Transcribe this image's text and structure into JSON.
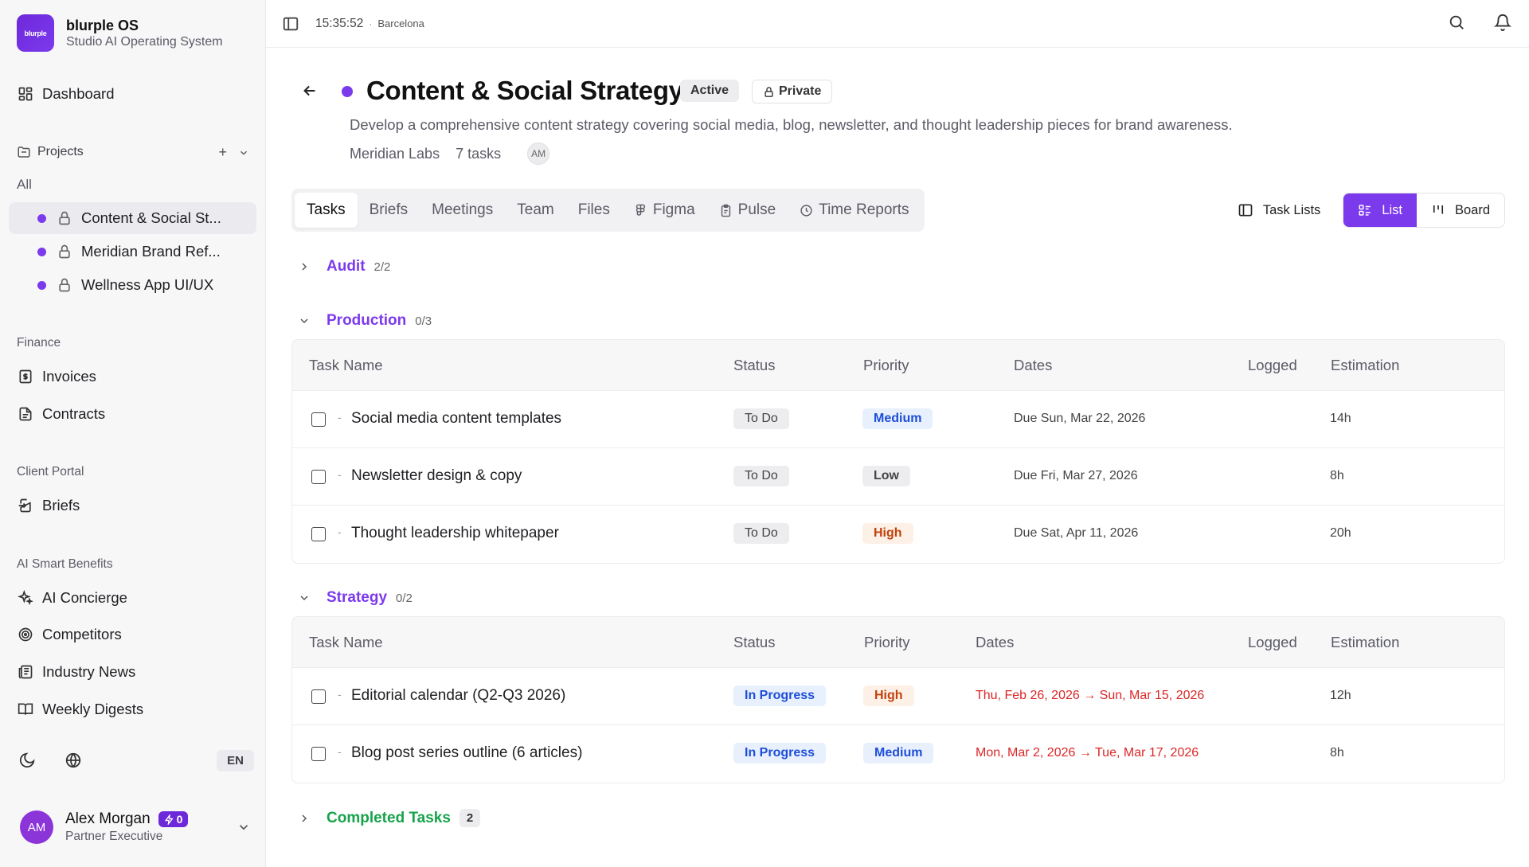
{
  "app": {
    "name": "blurple OS",
    "subtitle": "Studio AI Operating System",
    "logo_text": "blurple"
  },
  "sidebar": {
    "dashboard": "Dashboard",
    "projects_label": "Projects",
    "all_label": "All",
    "projects": [
      {
        "label": "Content & Social St..."
      },
      {
        "label": "Meridian Brand Ref..."
      },
      {
        "label": "Wellness App UI/UX"
      }
    ],
    "finance_label": "Finance",
    "finance_items": [
      {
        "label": "Invoices"
      },
      {
        "label": "Contracts"
      }
    ],
    "client_portal_label": "Client Portal",
    "client_items": [
      {
        "label": "Briefs"
      }
    ],
    "ai_label": "AI Smart Benefits",
    "ai_items": [
      {
        "label": "AI Concierge"
      },
      {
        "label": "Competitors"
      },
      {
        "label": "Industry News"
      },
      {
        "label": "Weekly Digests"
      }
    ],
    "language": "EN"
  },
  "user": {
    "initials": "AM",
    "name": "Alex Morgan",
    "role": "Partner Executive",
    "credits": "0"
  },
  "topbar": {
    "time": "15:35:52",
    "separator": "·",
    "city": "Barcelona"
  },
  "project": {
    "title": "Content & Social Strategy",
    "status": "Active",
    "visibility": "Private",
    "description": "Develop a comprehensive content strategy covering social media, blog, newsletter, and thought leadership pieces for brand awareness.",
    "client": "Meridian Labs",
    "task_count": "7 tasks",
    "member_initials": "AM",
    "accent_color": "#7c3aed"
  },
  "tabs": [
    {
      "label": "Tasks"
    },
    {
      "label": "Briefs"
    },
    {
      "label": "Meetings"
    },
    {
      "label": "Team"
    },
    {
      "label": "Files"
    },
    {
      "label": "Figma"
    },
    {
      "label": "Pulse"
    },
    {
      "label": "Time Reports"
    }
  ],
  "view": {
    "task_lists": "Task Lists",
    "list": "List",
    "board": "Board"
  },
  "columns": {
    "task_name": "Task Name",
    "status": "Status",
    "priority": "Priority",
    "dates": "Dates",
    "logged": "Logged",
    "estimation": "Estimation"
  },
  "groups": {
    "audit": {
      "name": "Audit",
      "count": "2/2"
    },
    "production": {
      "name": "Production",
      "count": "0/3",
      "rows": [
        {
          "name": "Social media content templates",
          "status": "To Do",
          "priority": "Medium",
          "dates": "Due Sun, Mar 22, 2026",
          "logged": "",
          "estimation": "14h"
        },
        {
          "name": "Newsletter design & copy",
          "status": "To Do",
          "priority": "Low",
          "dates": "Due Fri, Mar 27, 2026",
          "logged": "",
          "estimation": "8h"
        },
        {
          "name": "Thought leadership whitepaper",
          "status": "To Do",
          "priority": "High",
          "dates": "Due Sat, Apr 11, 2026",
          "logged": "",
          "estimation": "20h"
        }
      ]
    },
    "strategy": {
      "name": "Strategy",
      "count": "0/2",
      "rows": [
        {
          "name": "Editorial calendar (Q2-Q3 2026)",
          "status": "In Progress",
          "priority": "High",
          "dates": "Thu, Feb 26, 2026 → Sun, Mar 15, 2026",
          "logged": "",
          "estimation": "12h"
        },
        {
          "name": "Blog post series outline (6 articles)",
          "status": "In Progress",
          "priority": "Medium",
          "dates": "Mon, Mar 2, 2026 → Tue, Mar 17, 2026",
          "logged": "",
          "estimation": "8h"
        }
      ]
    },
    "completed": {
      "name": "Completed Tasks",
      "count": "2"
    }
  },
  "row_dash": "-"
}
